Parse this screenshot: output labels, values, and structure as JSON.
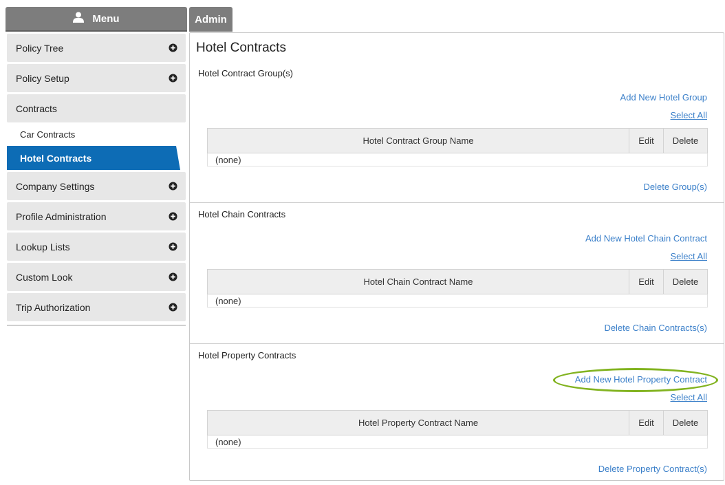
{
  "sidebar": {
    "header": "Menu",
    "items": [
      {
        "label": "Policy Tree",
        "icon": "plus-circle-icon"
      },
      {
        "label": "Policy Setup",
        "icon": "plus-circle-icon"
      },
      {
        "label": "Contracts"
      },
      {
        "label": "Company Settings",
        "icon": "plus-circle-icon"
      },
      {
        "label": "Profile Administration",
        "icon": "plus-circle-icon"
      },
      {
        "label": "Lookup Lists",
        "icon": "plus-circle-icon"
      },
      {
        "label": "Custom Look",
        "icon": "plus-circle-icon"
      },
      {
        "label": "Trip Authorization",
        "icon": "plus-circle-icon"
      }
    ],
    "sub_items": [
      {
        "label": "Car Contracts",
        "active": false
      },
      {
        "label": "Hotel Contracts",
        "active": true
      }
    ]
  },
  "tab": {
    "label": "Admin"
  },
  "page": {
    "title": "Hotel Contracts"
  },
  "sections": [
    {
      "title": "Hotel Contract Group(s)",
      "add_link": "Add New Hotel Group",
      "select_all": "Select All",
      "columns": [
        "Hotel Contract Group Name",
        "Edit",
        "Delete"
      ],
      "empty_text": "(none)",
      "delete_link": "Delete Group(s)"
    },
    {
      "title": "Hotel Chain Contracts",
      "add_link": "Add New Hotel Chain Contract",
      "select_all": "Select All",
      "columns": [
        "Hotel Chain Contract Name",
        "Edit",
        "Delete"
      ],
      "empty_text": "(none)",
      "delete_link": "Delete Chain Contracts(s)"
    },
    {
      "title": "Hotel Property Contracts",
      "add_link": "Add New Hotel Property Contract",
      "select_all": "Select All",
      "columns": [
        "Hotel Property Contract Name",
        "Edit",
        "Delete"
      ],
      "empty_text": "(none)",
      "delete_link": "Delete Property Contract(s)"
    }
  ],
  "colors": {
    "accent": "#0d6cb5",
    "link": "#3a7fc9",
    "header_gray": "#7d7d7d",
    "highlight": "#82b320"
  }
}
